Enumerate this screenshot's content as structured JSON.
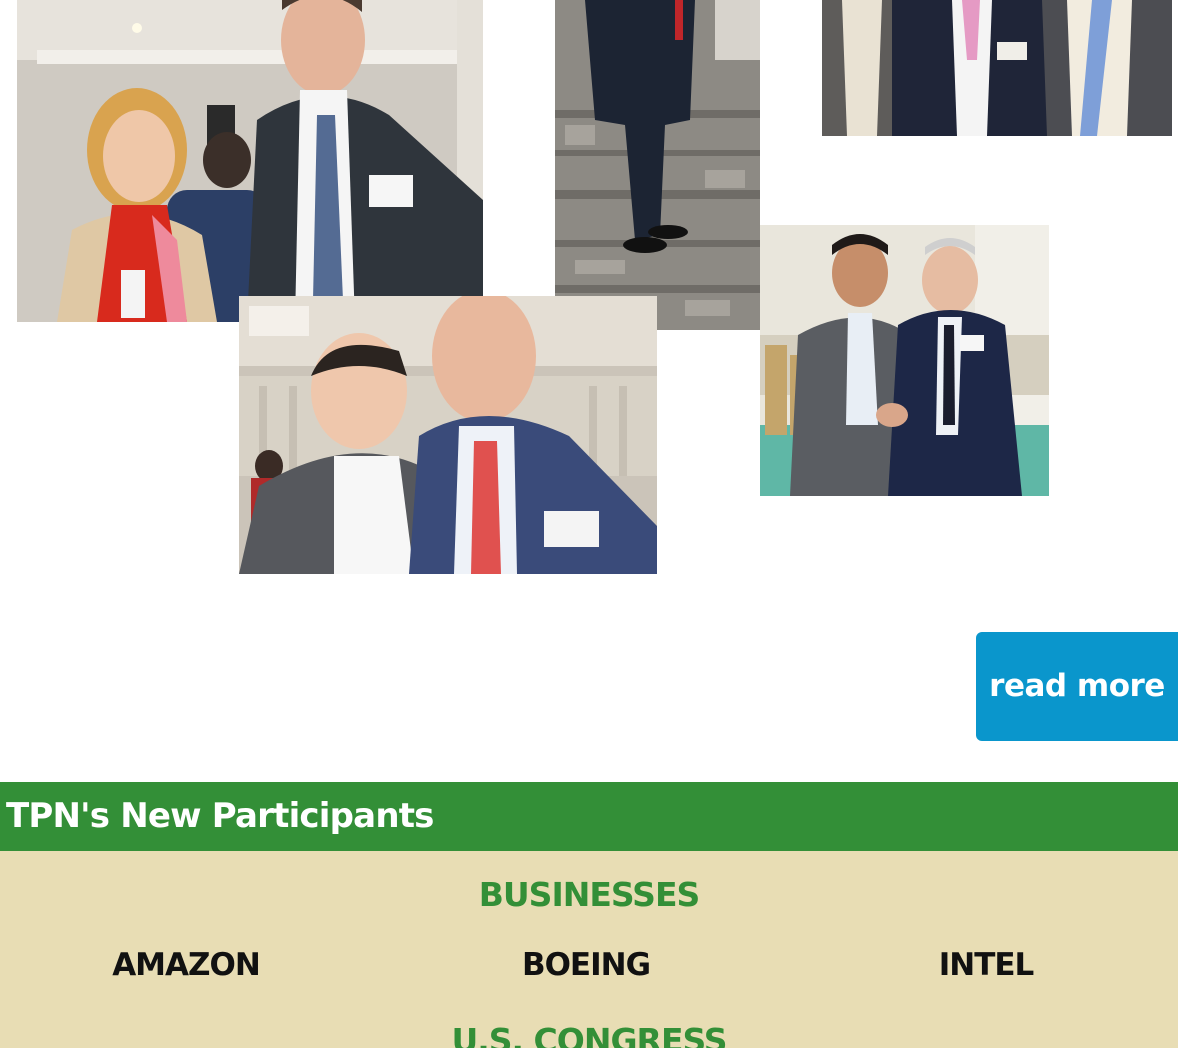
{
  "gallery": {
    "photos": [
      {
        "name": "photo-woman-and-man-in-suit"
      },
      {
        "name": "photo-man-standing-carpet"
      },
      {
        "name": "photo-three-men-suits"
      },
      {
        "name": "photo-two-men-smiling"
      },
      {
        "name": "photo-handshake"
      }
    ]
  },
  "actions": {
    "read_more_label": "read more"
  },
  "participants": {
    "header": "TPN's New Participants",
    "businesses_title": "BUSINESSES",
    "businesses": [
      "AMAZON",
      "BOEING",
      "INTEL"
    ],
    "congress_title": "U.S. CONGRESS"
  },
  "colors": {
    "button_blue": "#0a96cc",
    "header_green": "#338f37",
    "body_beige": "#e8ddb4",
    "title_green": "#338f37"
  }
}
